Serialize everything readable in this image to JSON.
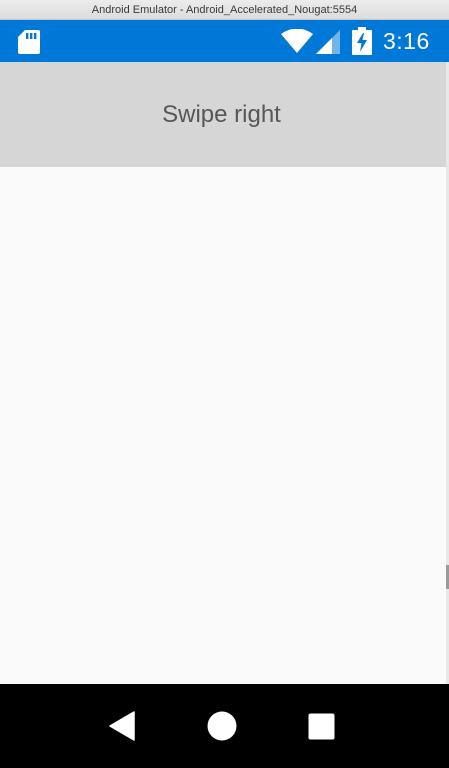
{
  "window": {
    "title": "Android Emulator - Android_Accelerated_Nougat:5554"
  },
  "status_bar": {
    "time": "3:16",
    "background_color": "#0078d7",
    "icons": [
      "sd-card-icon",
      "wifi-icon",
      "cellular-signal-icon",
      "battery-charging-icon"
    ]
  },
  "header": {
    "text": "Swipe right",
    "background_color": "#d6d6d6"
  },
  "nav_bar": {
    "buttons": [
      "back-icon",
      "home-icon",
      "recents-icon"
    ]
  }
}
